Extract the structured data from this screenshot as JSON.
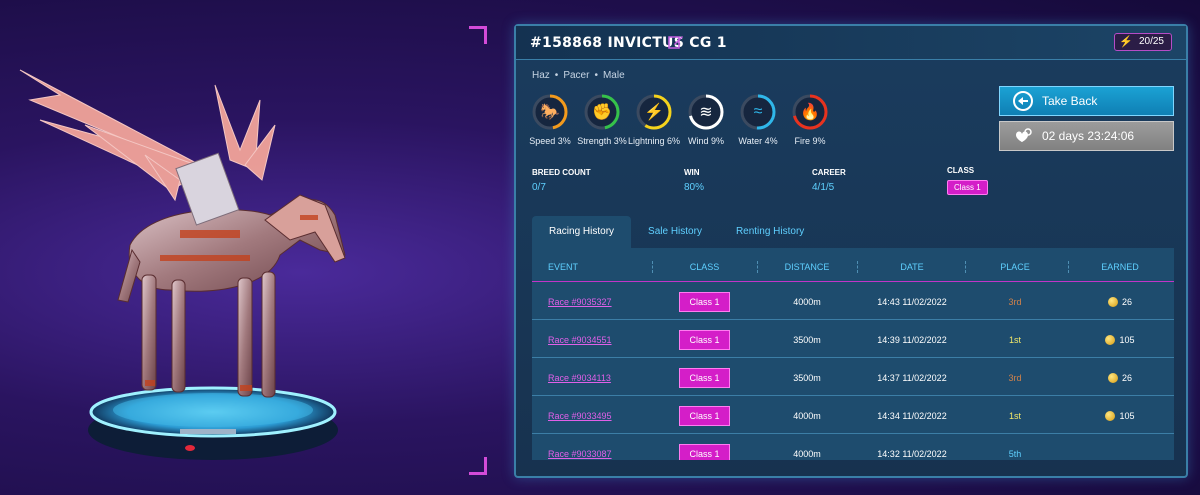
{
  "horse": {
    "title": "#158868 INVICTUS CG 1",
    "tags": [
      "Haz",
      "Pacer",
      "Male"
    ]
  },
  "energy": {
    "value": "20/25"
  },
  "stats": [
    {
      "label": "Speed 3%",
      "icon": "horse-icon",
      "color": "#f39a1c",
      "percent": 3
    },
    {
      "label": "Strength 3%",
      "icon": "fist-icon",
      "color": "#35c24a",
      "percent": 3
    },
    {
      "label": "Lightning 6%",
      "icon": "lightning-icon",
      "color": "#f4d21c",
      "percent": 6
    },
    {
      "label": "Wind 9%",
      "icon": "wind-icon",
      "color": "#ffffff",
      "percent": 9
    },
    {
      "label": "Water 4%",
      "icon": "water-icon",
      "color": "#2fb7ea",
      "percent": 4
    },
    {
      "label": "Fire 9%",
      "icon": "fire-icon",
      "color": "#e8321e",
      "percent": 9
    }
  ],
  "info": {
    "breed_count_label": "BREED COUNT",
    "breed_count_value": "0/7",
    "win_label": "WIN",
    "win_value": "80%",
    "career_label": "CAREER",
    "career_value": "4/1/5",
    "class_label": "CLASS",
    "class_value": "Class 1"
  },
  "actions": {
    "take_back": "Take Back",
    "timer": "02 days 23:24:06"
  },
  "tabs": [
    {
      "label": "Racing History",
      "active": true
    },
    {
      "label": "Sale History",
      "active": false
    },
    {
      "label": "Renting History",
      "active": false
    }
  ],
  "table": {
    "headers": [
      "EVENT",
      "CLASS",
      "DISTANCE",
      "DATE",
      "PLACE",
      "EARNED"
    ],
    "rows": [
      {
        "event": "Race #9035327",
        "class": "Class 1",
        "distance": "4000m",
        "date": "14:43 11/02/2022",
        "place": "3rd",
        "earned": "26"
      },
      {
        "event": "Race #9034551",
        "class": "Class 1",
        "distance": "3500m",
        "date": "14:39 11/02/2022",
        "place": "1st",
        "earned": "105"
      },
      {
        "event": "Race #9034113",
        "class": "Class 1",
        "distance": "3500m",
        "date": "14:37 11/02/2022",
        "place": "3rd",
        "earned": "26"
      },
      {
        "event": "Race #9033495",
        "class": "Class 1",
        "distance": "4000m",
        "date": "14:34 11/02/2022",
        "place": "1st",
        "earned": "105"
      },
      {
        "event": "Race #9033087",
        "class": "Class 1",
        "distance": "4000m",
        "date": "14:32 11/02/2022",
        "place": "5th",
        "earned": ""
      }
    ]
  },
  "colors": {
    "accent_magenta": "#d41ec8",
    "accent_cyan": "#5fd0ff",
    "panel_bg": "#17324f"
  }
}
